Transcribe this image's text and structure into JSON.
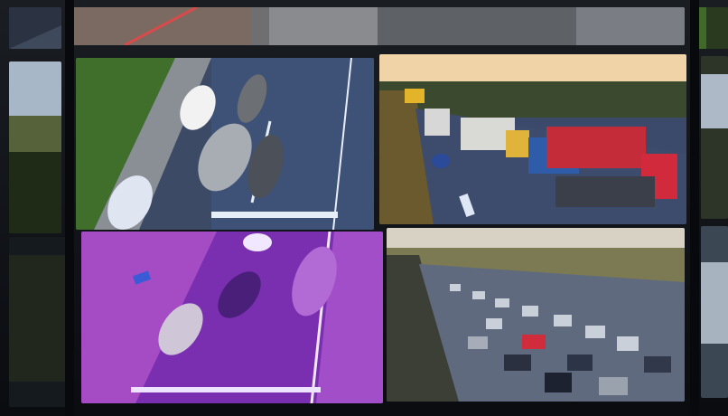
{
  "scene": {
    "description_kind": "photo-of-video-wall",
    "feeds": [
      {
        "id": "top-strip",
        "palette": {
          "road": "#6f6f72",
          "grass": "#56624a"
        }
      },
      {
        "id": "highway-shoulder-day",
        "palette": {
          "road": "#3c4a66",
          "grass": "#3f6f2b",
          "line": "#e8eef7"
        }
      },
      {
        "id": "truck-queue-dusk",
        "palette": {
          "sky": "#f0d3a6",
          "road": "#3b4a6a",
          "trees": "#3b4a2e",
          "truck_red": "#c52c3a",
          "truck_blue": "#2f5ca8"
        }
      },
      {
        "id": "night-infrared-purple",
        "palette": {
          "road": "#7a2fb0",
          "shoulder": "#a54cc4",
          "line": "#f2e6ff"
        }
      },
      {
        "id": "traffic-jam-day",
        "palette": {
          "sky": "#d8d2c4",
          "trees": "#7b7a52",
          "road": "#5b6476"
        }
      }
    ]
  },
  "colors": {
    "bezel": "#07090c",
    "wall": "#0c0f14"
  }
}
